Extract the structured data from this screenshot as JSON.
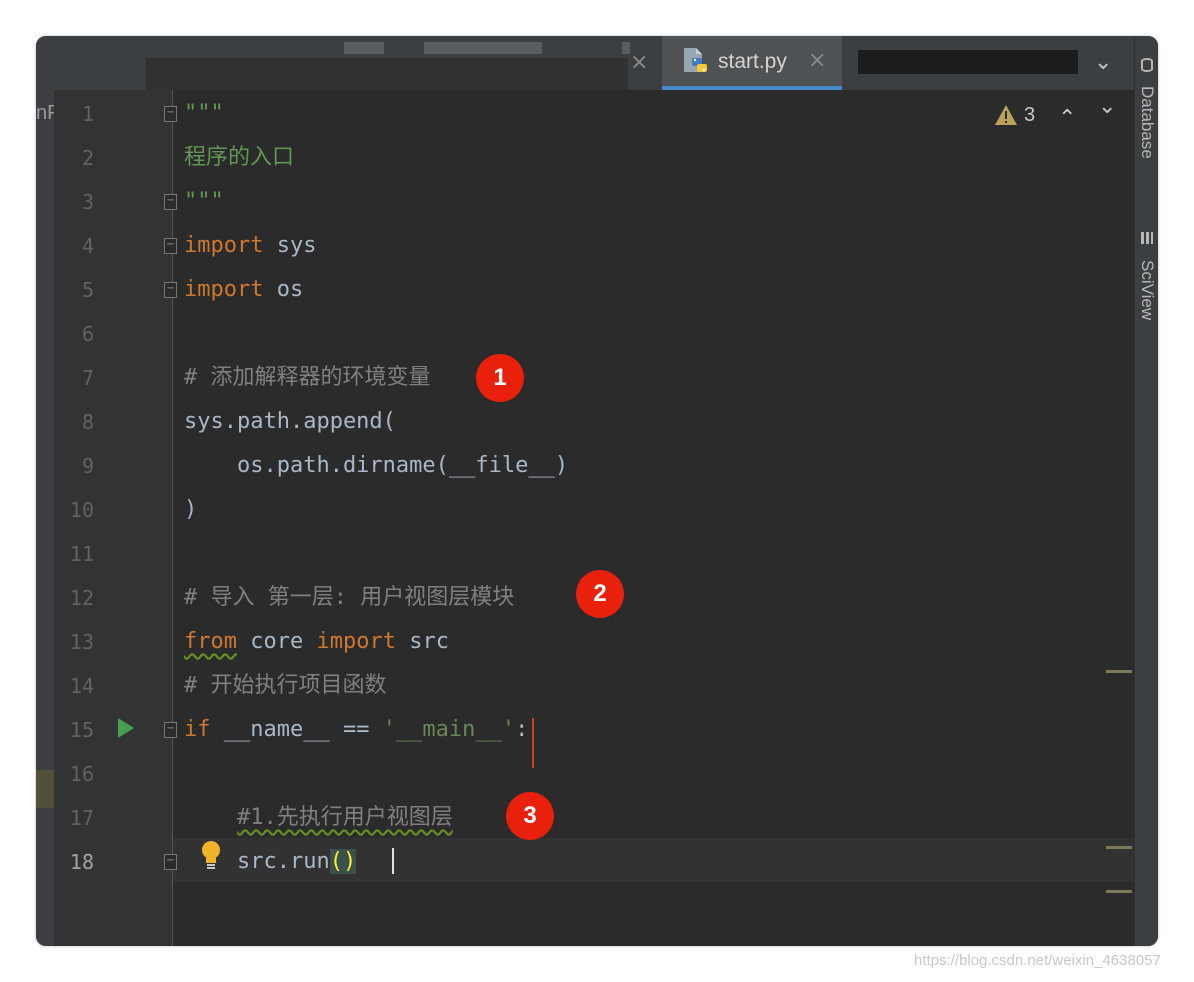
{
  "tabs": {
    "active_label": "start.py",
    "close_glyph": "×",
    "more_glyph": "⌄"
  },
  "tool_window": {
    "database_label": "Database",
    "sciview_label": "SciView"
  },
  "left_panel_label": "nP",
  "inspection": {
    "warning_count": "3",
    "warning_glyph": "⚠",
    "up_glyph": "⌃",
    "down_glyph": "⌄"
  },
  "editor": {
    "current_line": 18,
    "line_numbers": [
      "1",
      "2",
      "3",
      "4",
      "5",
      "6",
      "7",
      "8",
      "9",
      "10",
      "11",
      "12",
      "13",
      "14",
      "15",
      "16",
      "17",
      "18"
    ],
    "lines": {
      "l1": "\"\"\"",
      "l2": "程序的入口",
      "l3": "\"\"\"",
      "l4_kw": "import",
      "l4_rest": " sys",
      "l5_kw": "import",
      "l5_rest": " os",
      "l7": "# 添加解释器的环境变量",
      "l8": "sys.path.append(",
      "l9": "    os.path.dirname(__file__)",
      "l10": ")",
      "l12": "# 导入 第一层: 用户视图层模块",
      "l13_kw1": "from",
      "l13_mid": " core ",
      "l13_kw2": "import",
      "l13_rest": " src",
      "l14": "# 开始执行项目函数",
      "l15_kw": "if",
      "l15_mid": " __name__ == ",
      "l15_str": "'__main__'",
      "l15_end": ":",
      "l17_indent": "    ",
      "l17": "#1.先执行用户视图层",
      "l18_code": "    src.run",
      "l18_paren": "()"
    }
  },
  "badges": [
    "1",
    "2",
    "3"
  ],
  "icons": {
    "run": "▶",
    "bulb": "💡",
    "python": "python-file"
  },
  "watermark": "https://blog.csdn.net/weixin_4638057"
}
